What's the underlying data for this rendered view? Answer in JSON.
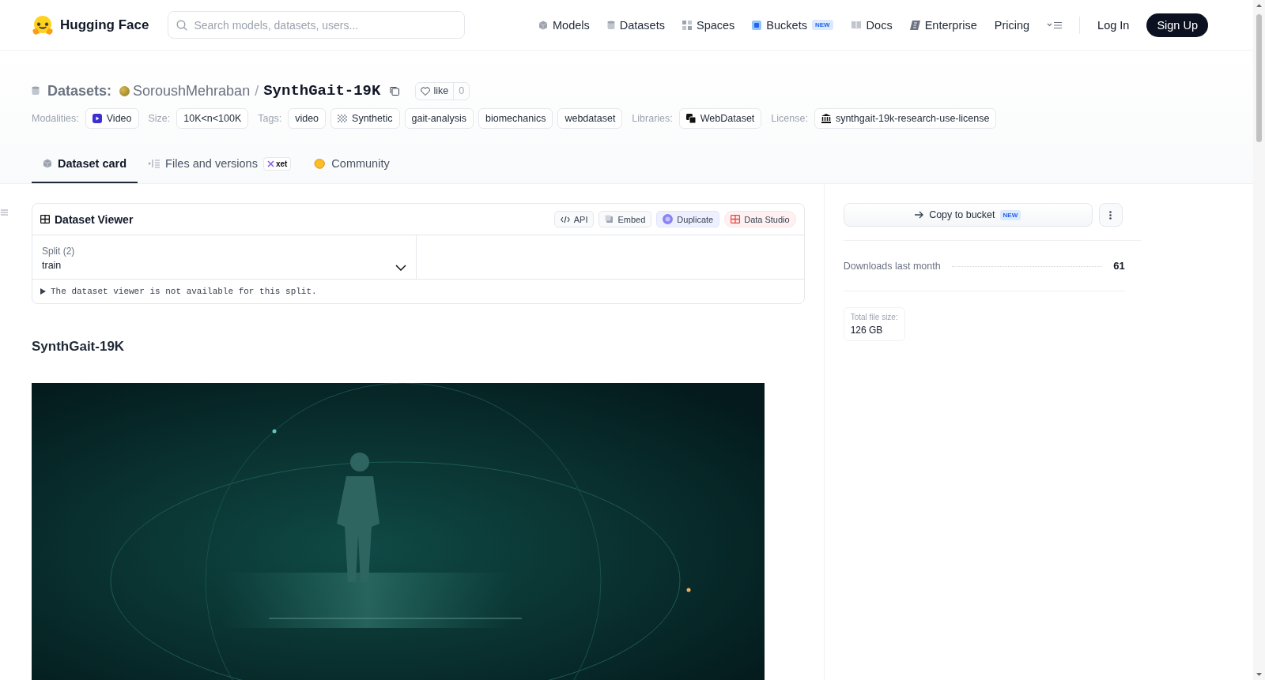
{
  "header": {
    "brand": "Hugging Face",
    "search": {
      "placeholder": "Search models, datasets, users..."
    },
    "nav": [
      {
        "label": "Models",
        "kind": "cube"
      },
      {
        "label": "Datasets",
        "kind": "cylinder"
      },
      {
        "label": "Spaces",
        "kind": "grid"
      },
      {
        "label": "Buckets",
        "kind": "bucket",
        "badge": "NEW"
      },
      {
        "label": "Docs",
        "kind": "book"
      },
      {
        "label": "Enterprise",
        "kind": "enterprise"
      },
      {
        "label": "Pricing",
        "kind": "plain"
      }
    ],
    "login": "Log In",
    "signup": "Sign Up"
  },
  "repo": {
    "type_label": "Datasets:",
    "owner": "SoroushMehraban",
    "separator": "/",
    "name": "SynthGait-19K",
    "like": {
      "label": "like",
      "count": "0"
    }
  },
  "meta": [
    {
      "label": "Modalities:",
      "chips": [
        {
          "text": "Video",
          "kind": "video"
        }
      ]
    },
    {
      "label": "Size:",
      "chips": [
        {
          "text": "10K<n<100K",
          "kind": "plain"
        }
      ]
    },
    {
      "label": "Tags:",
      "chips": [
        {
          "text": "video",
          "kind": "plain"
        },
        {
          "text": "Synthetic",
          "kind": "synthetic"
        },
        {
          "text": "gait-analysis",
          "kind": "plain"
        },
        {
          "text": "biomechanics",
          "kind": "plain"
        },
        {
          "text": "webdataset",
          "kind": "plain"
        }
      ]
    },
    {
      "label": "Libraries:",
      "chips": [
        {
          "text": "WebDataset",
          "kind": "library"
        }
      ]
    },
    {
      "label": "License:",
      "chips": [
        {
          "text": "synthgait-19k-research-use-license",
          "kind": "license"
        }
      ]
    }
  ],
  "tabs": [
    {
      "label": "Dataset card",
      "kind": "cube",
      "selected": true
    },
    {
      "label": "Files and versions",
      "kind": "files",
      "badge": "xet",
      "selected": false
    },
    {
      "label": "Community",
      "kind": "community",
      "selected": false
    }
  ],
  "viewer": {
    "title": "Dataset Viewer",
    "actions": [
      {
        "label": "API",
        "kind": "api"
      },
      {
        "label": "Embed",
        "kind": "embed"
      },
      {
        "label": "Duplicate",
        "kind": "duplicate"
      },
      {
        "label": "Data Studio",
        "kind": "studio"
      }
    ],
    "split": {
      "label": "Split (2)",
      "value": "train"
    },
    "notice": "The dataset viewer is not available for this split."
  },
  "card": {
    "heading": "SynthGait-19K"
  },
  "sidebar": {
    "copy_button": {
      "label": "Copy to bucket",
      "badge": "NEW"
    },
    "downloads": {
      "label": "Downloads last month",
      "value": "61"
    },
    "file_size": {
      "label": "Total file size:",
      "value": "126 GB"
    }
  }
}
